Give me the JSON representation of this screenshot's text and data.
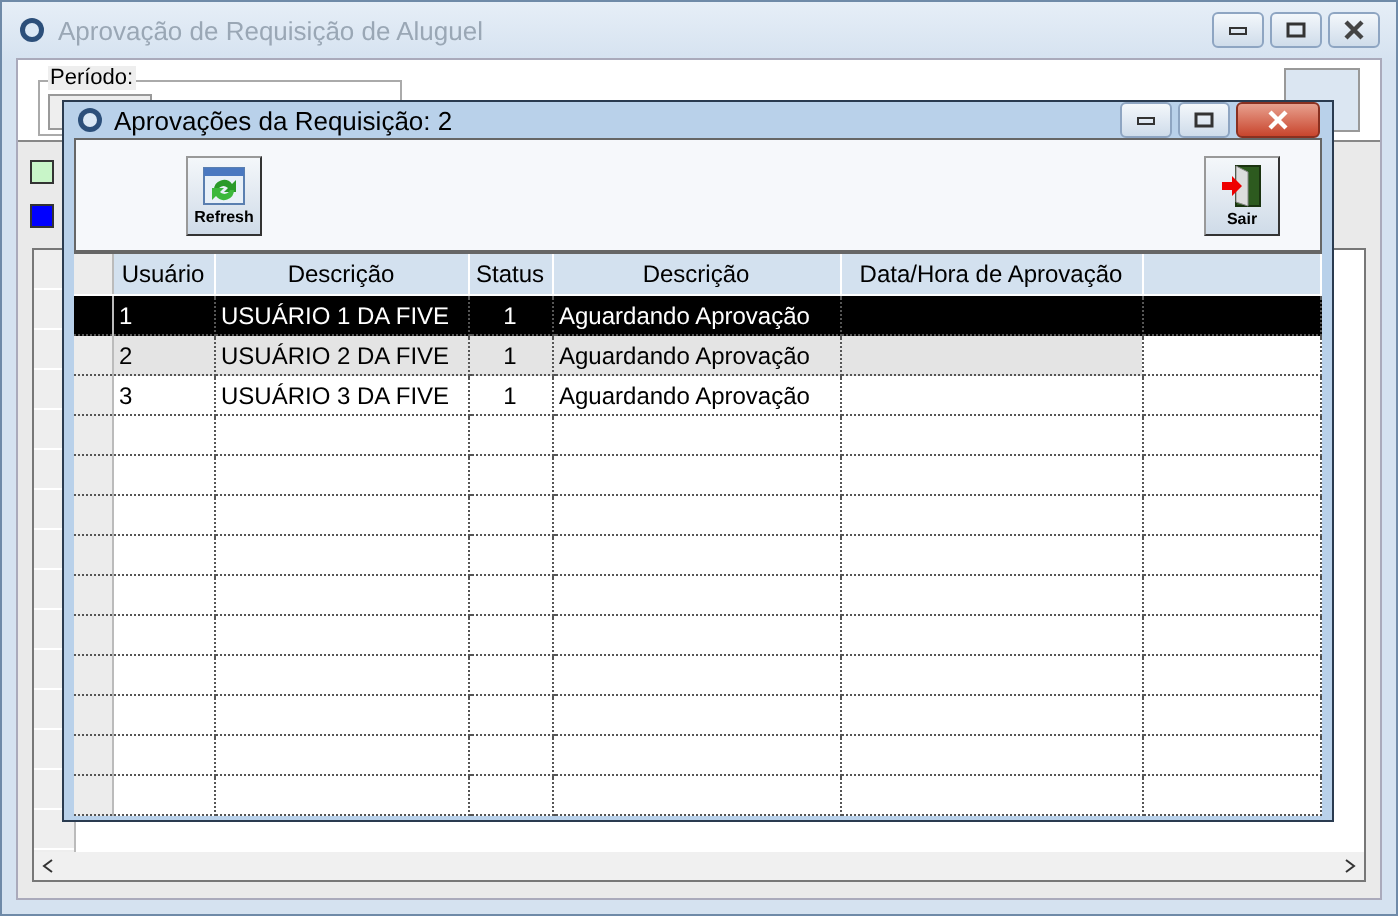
{
  "main_window": {
    "title": "Aprovação de Requisição de Aluguel",
    "period_label": "Período:",
    "legend": [
      {
        "color": "#c8f5c8"
      },
      {
        "color": "#0000ff"
      }
    ]
  },
  "dialog": {
    "title": "Aprovações da Requisição: 2",
    "toolbar": [
      {
        "kind": "refresh",
        "label": "Refresh"
      },
      {
        "kind": "exit",
        "label": "Sair"
      }
    ],
    "table": {
      "columns": [
        "Usuário",
        "Descrição",
        "Status",
        "Descrição",
        "Data/Hora de Aprovação"
      ],
      "rows": [
        {
          "cells": [
            "1",
            "USUÁRIO 1 DA FIVE",
            "1",
            "Aguardando Aprovação",
            ""
          ],
          "selected": true,
          "highlighted": false
        },
        {
          "cells": [
            "2",
            "USUÁRIO 2 DA FIVE",
            "1",
            "Aguardando Aprovação",
            ""
          ],
          "selected": false,
          "highlighted": true
        },
        {
          "cells": [
            "3",
            "USUÁRIO 3 DA FIVE",
            "1",
            "Aguardando Aprovação",
            ""
          ],
          "selected": false,
          "highlighted": false
        }
      ]
    }
  }
}
